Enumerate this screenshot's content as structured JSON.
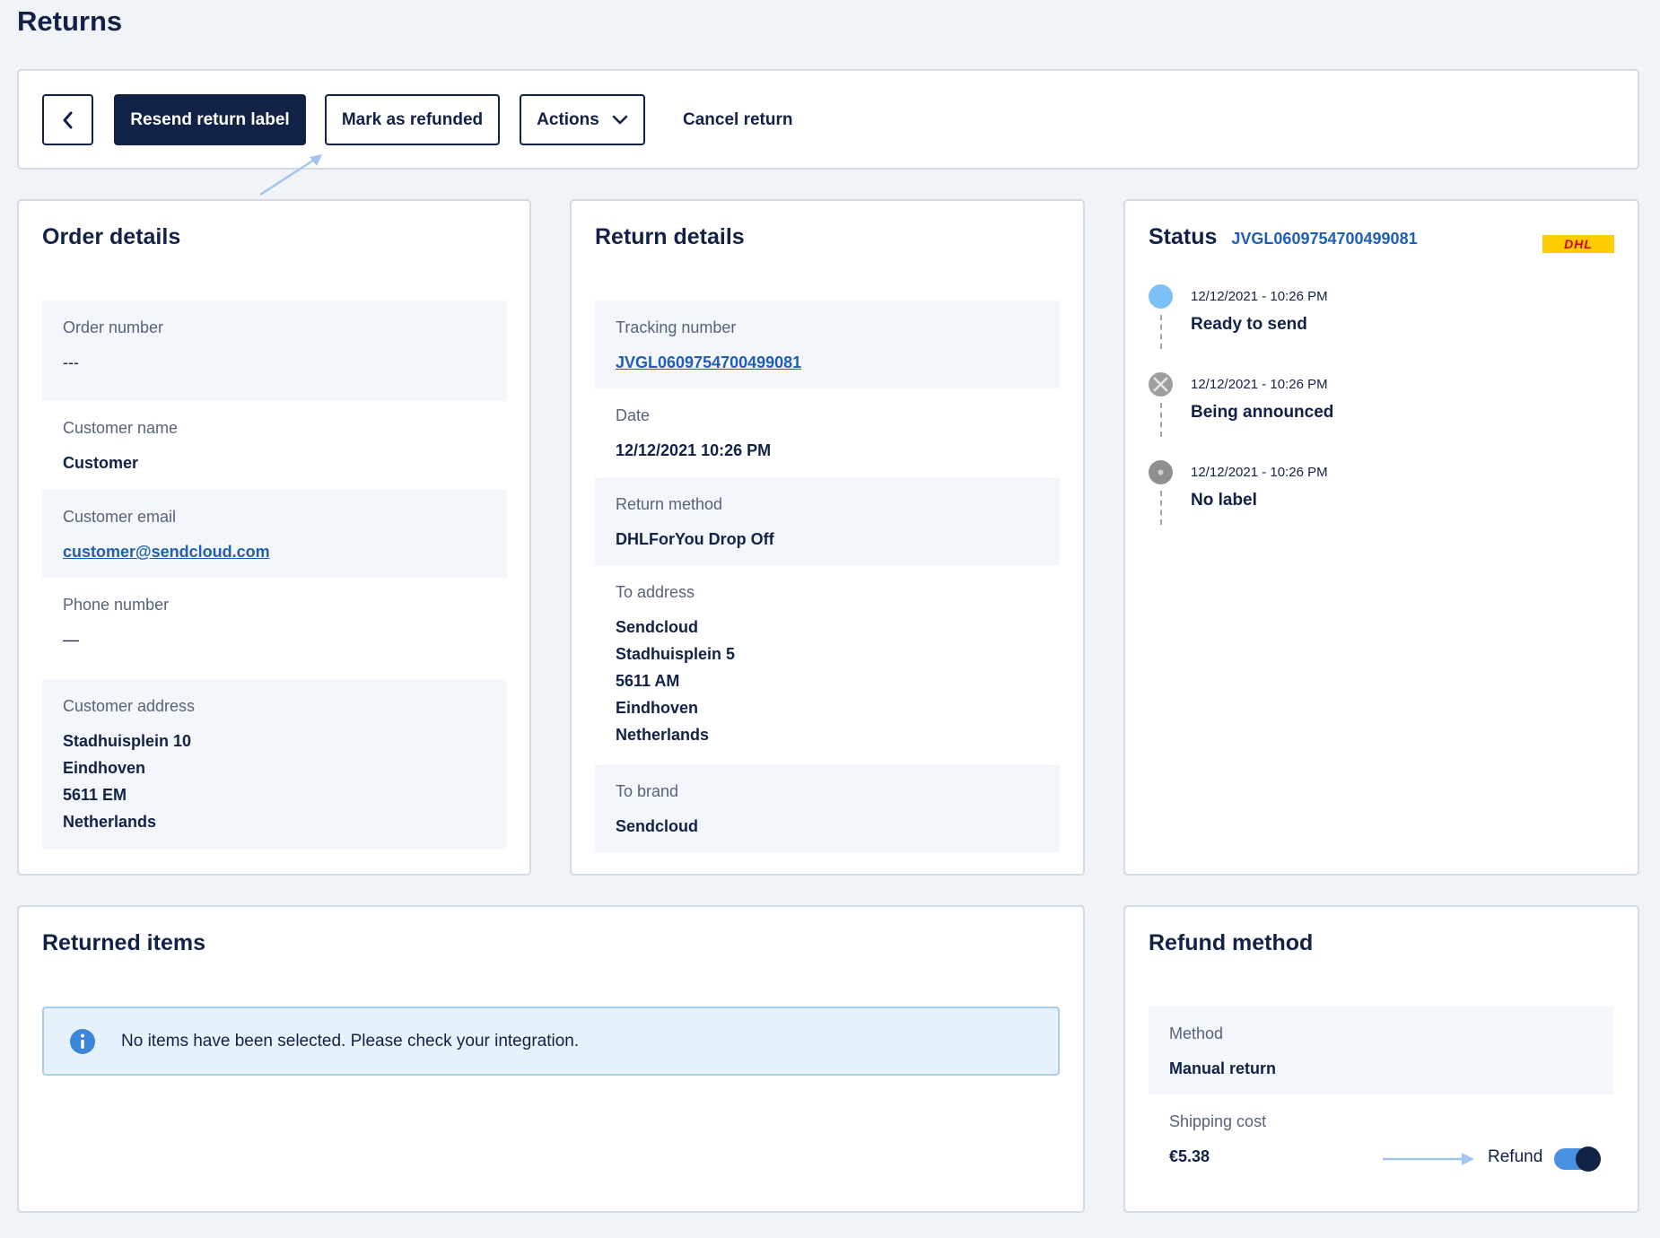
{
  "page": {
    "title": "Returns"
  },
  "toolbar": {
    "resend_label": "Resend return label",
    "refunded_label": "Mark as refunded",
    "actions_label": "Actions",
    "cancel_label": "Cancel return"
  },
  "order": {
    "title": "Order details",
    "fields": [
      {
        "label": "Order number",
        "value": "---"
      },
      {
        "label": "Customer name",
        "value": "Customer"
      },
      {
        "label": "Customer email",
        "value": "customer@sendcloud.com"
      },
      {
        "label": "Phone number",
        "value": "—"
      },
      {
        "label": "Customer address",
        "lines": [
          "Stadhuisplein 10",
          "Eindhoven",
          "5611 EM",
          "Netherlands"
        ]
      }
    ]
  },
  "return": {
    "title": "Return details",
    "fields": [
      {
        "label": "Tracking number",
        "value": "JVGL0609754700499081"
      },
      {
        "label": "Date",
        "value": "12/12/2021 10:26 PM"
      },
      {
        "label": "Return method",
        "value": "DHLForYou Drop Off"
      },
      {
        "label": "To address",
        "lines": [
          "Sendcloud",
          "Stadhuisplein 5",
          "5611 AM",
          "Eindhoven",
          "Netherlands"
        ]
      },
      {
        "label": "To brand",
        "value": "Sendcloud"
      }
    ]
  },
  "status": {
    "title": "Status",
    "tracking": "JVGL0609754700499081",
    "carrier_logo": "DHL",
    "timeline": [
      {
        "time": "12/12/2021 - 10:26 PM",
        "text": "Ready to send",
        "dot_color": "#7cc0f5"
      },
      {
        "time": "12/12/2021 - 10:26 PM",
        "text": "Being announced",
        "dot_color": "#9e9e9e"
      },
      {
        "time": "12/12/2021 - 10:26 PM",
        "text": "No label",
        "dot_color": "#8f8f8f"
      }
    ]
  },
  "items": {
    "title": "Returned items",
    "info_message": "No items have been selected. Please check your integration."
  },
  "refund": {
    "title": "Refund method",
    "method_label": "Method",
    "method_value": "Manual return",
    "shipping_label": "Shipping cost",
    "shipping_value": "€5.38",
    "refund_toggle_label": "Refund",
    "refund_enabled": true
  },
  "colors": {
    "navy": "#122146",
    "link": "#1f5eb5",
    "background": "#f0f4f8",
    "info_bg": "#e6f2fb",
    "toggle_track": "#4a90e2",
    "annotation_arrow": "#a3c4f3"
  },
  "icons": {
    "back": "chevron-left-icon",
    "actions": "chevron-down-icon",
    "info": "info-icon"
  }
}
